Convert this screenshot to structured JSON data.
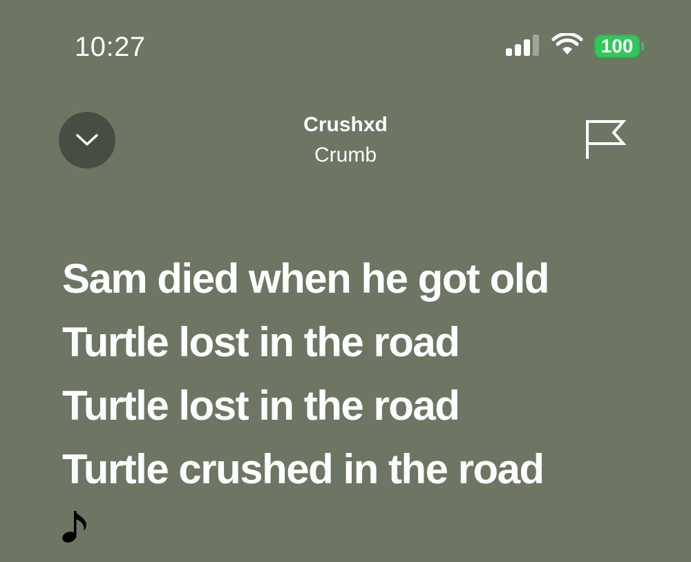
{
  "status_bar": {
    "time": "10:27",
    "battery_level": "100",
    "signal_bars_active": 3,
    "signal_bars_total": 4,
    "icons": [
      "signal-icon",
      "wifi-icon",
      "battery-icon"
    ],
    "battery_color": "#31c759"
  },
  "header": {
    "title": "Crushxd",
    "artist": "Crumb",
    "collapse_icon": "chevron-down-icon",
    "report_icon": "flag-icon"
  },
  "lyrics": {
    "lines": [
      "Sam died when he got old",
      "Turtle lost in the road",
      "Turtle lost in the road",
      "Turtle crushed in the road"
    ],
    "interlude_icon": "music-note-icon"
  },
  "colors": {
    "background": "#6c7662",
    "collapse_button": "#484d43",
    "text": "#ffffff"
  }
}
